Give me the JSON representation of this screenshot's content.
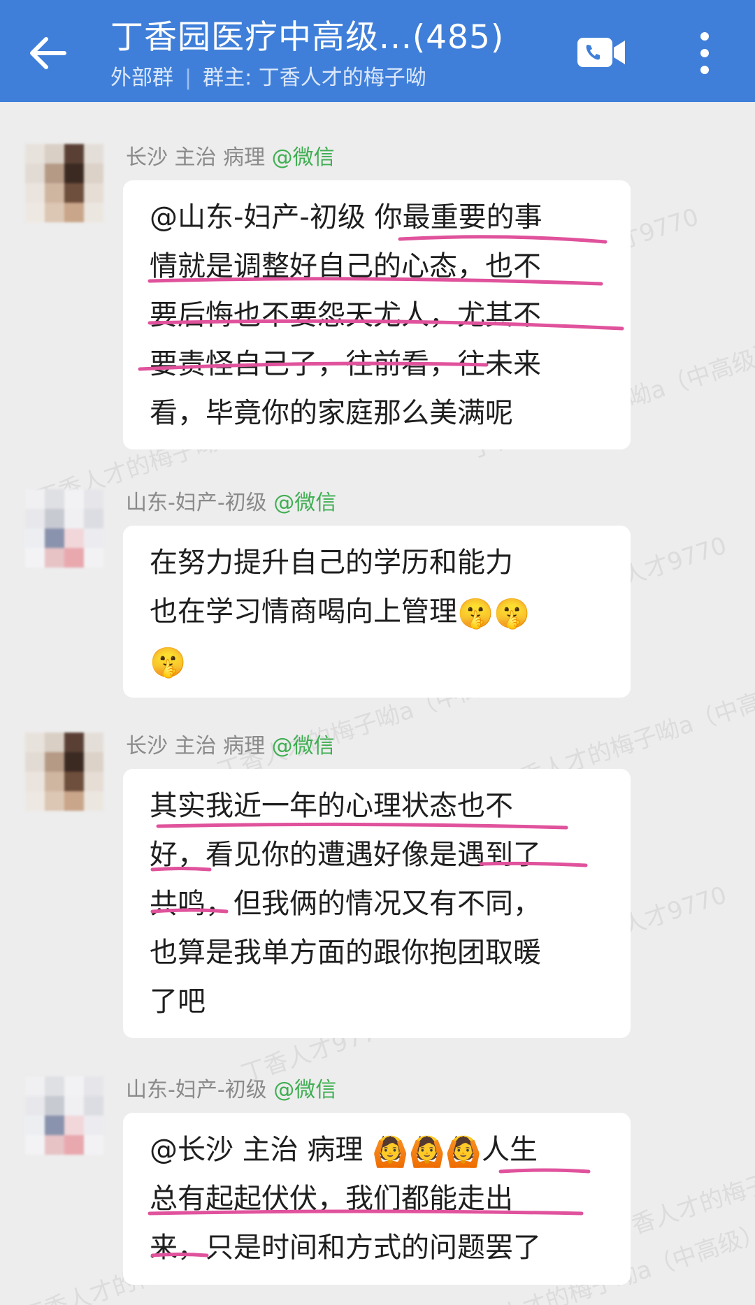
{
  "header": {
    "title": "丁香园医疗中高级...(485)",
    "group_type": "外部群",
    "owner": "群主: 丁香人才的梅子呦"
  },
  "icons": {
    "back": "arrow-left-icon",
    "video": "video-call-icon",
    "more": "more-vertical-icon"
  },
  "colors": {
    "header_bg": "#3f7fd9",
    "source_tag": "#3fae52",
    "underline": "#e0529c"
  },
  "messages": [
    {
      "sender": "长沙 主治 病理",
      "source": "@微信",
      "lines": [
        "@山东-妇产-初级 你最重要的事",
        "情就是调整好自己的心态，也不",
        "要后悔也不要怨天尤人，尤其不",
        "要责怪自己了，往前看，往未来",
        "看，毕竟你的家庭那么美满呢"
      ]
    },
    {
      "sender": "山东-妇产-初级",
      "source": "@微信",
      "lines": [
        "在努力提升自己的学历和能力",
        "也在学习情商喝向上管理"
      ],
      "emoji": [
        "🤫",
        "🤫",
        "🤫"
      ]
    },
    {
      "sender": "长沙 主治 病理",
      "source": "@微信",
      "lines": [
        "其实我近一年的心理状态也不",
        "好，看见你的遭遇好像是遇到了",
        "共鸣，但我俩的情况又有不同，",
        "也算是我单方面的跟你抱团取暖",
        "了吧"
      ]
    },
    {
      "sender": "山东-妇产-初级",
      "source": "@微信",
      "line1_start": "@长沙 主治 病理",
      "line1_end": "人生",
      "emoji": [
        "🙆",
        "🙆",
        "🙆"
      ],
      "lines": [
        "总有起起伏伏，我们都能走出",
        "来，只是时间和方式的问题罢了"
      ]
    }
  ],
  "watermark": {
    "text_a": "丁香人才的梅子呦a（中高级）",
    "text_b": "丁香人才9770"
  }
}
